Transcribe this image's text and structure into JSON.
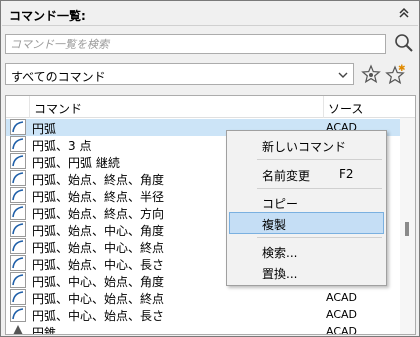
{
  "palette": {
    "title": "コマンド一覧:",
    "collapse_icon": "double-chevron-up-icon"
  },
  "search": {
    "placeholder": "コマンド一覧を検索",
    "icon": "search-icon"
  },
  "filter": {
    "selected": "すべてのコマンド",
    "icons": [
      "favorite-star-icon",
      "new-star-icon"
    ]
  },
  "list": {
    "headers": {
      "command": "コマンド",
      "source": "ソース"
    },
    "rows": [
      {
        "name": "円弧",
        "source": "ACAD"
      },
      {
        "name": "円弧、3 点",
        "source": ""
      },
      {
        "name": "円弧、円弧 継続",
        "source": ""
      },
      {
        "name": "円弧、始点、終点、角度",
        "source": ""
      },
      {
        "name": "円弧、始点、終点、半径",
        "source": ""
      },
      {
        "name": "円弧、始点、終点、方向",
        "source": ""
      },
      {
        "name": "円弧、始点、中心、角度",
        "source": ""
      },
      {
        "name": "円弧、始点、中心、終点",
        "source": ""
      },
      {
        "name": "円弧、始点、中心、長さ",
        "source": ""
      },
      {
        "name": "円弧、中心、始点、角度",
        "source": ""
      },
      {
        "name": "円弧、中心、始点、終点",
        "source": "ACAD"
      },
      {
        "name": "円弧、中心、始点、長さ",
        "source": "ACAD"
      },
      {
        "name": "円錐",
        "source": "ACAD"
      }
    ]
  },
  "context_menu": {
    "new_command": "新しいコマンド",
    "rename": "名前変更",
    "rename_shortcut": "F2",
    "copy": "コピー",
    "duplicate": "複製",
    "find": "検索...",
    "replace": "置換..."
  }
}
